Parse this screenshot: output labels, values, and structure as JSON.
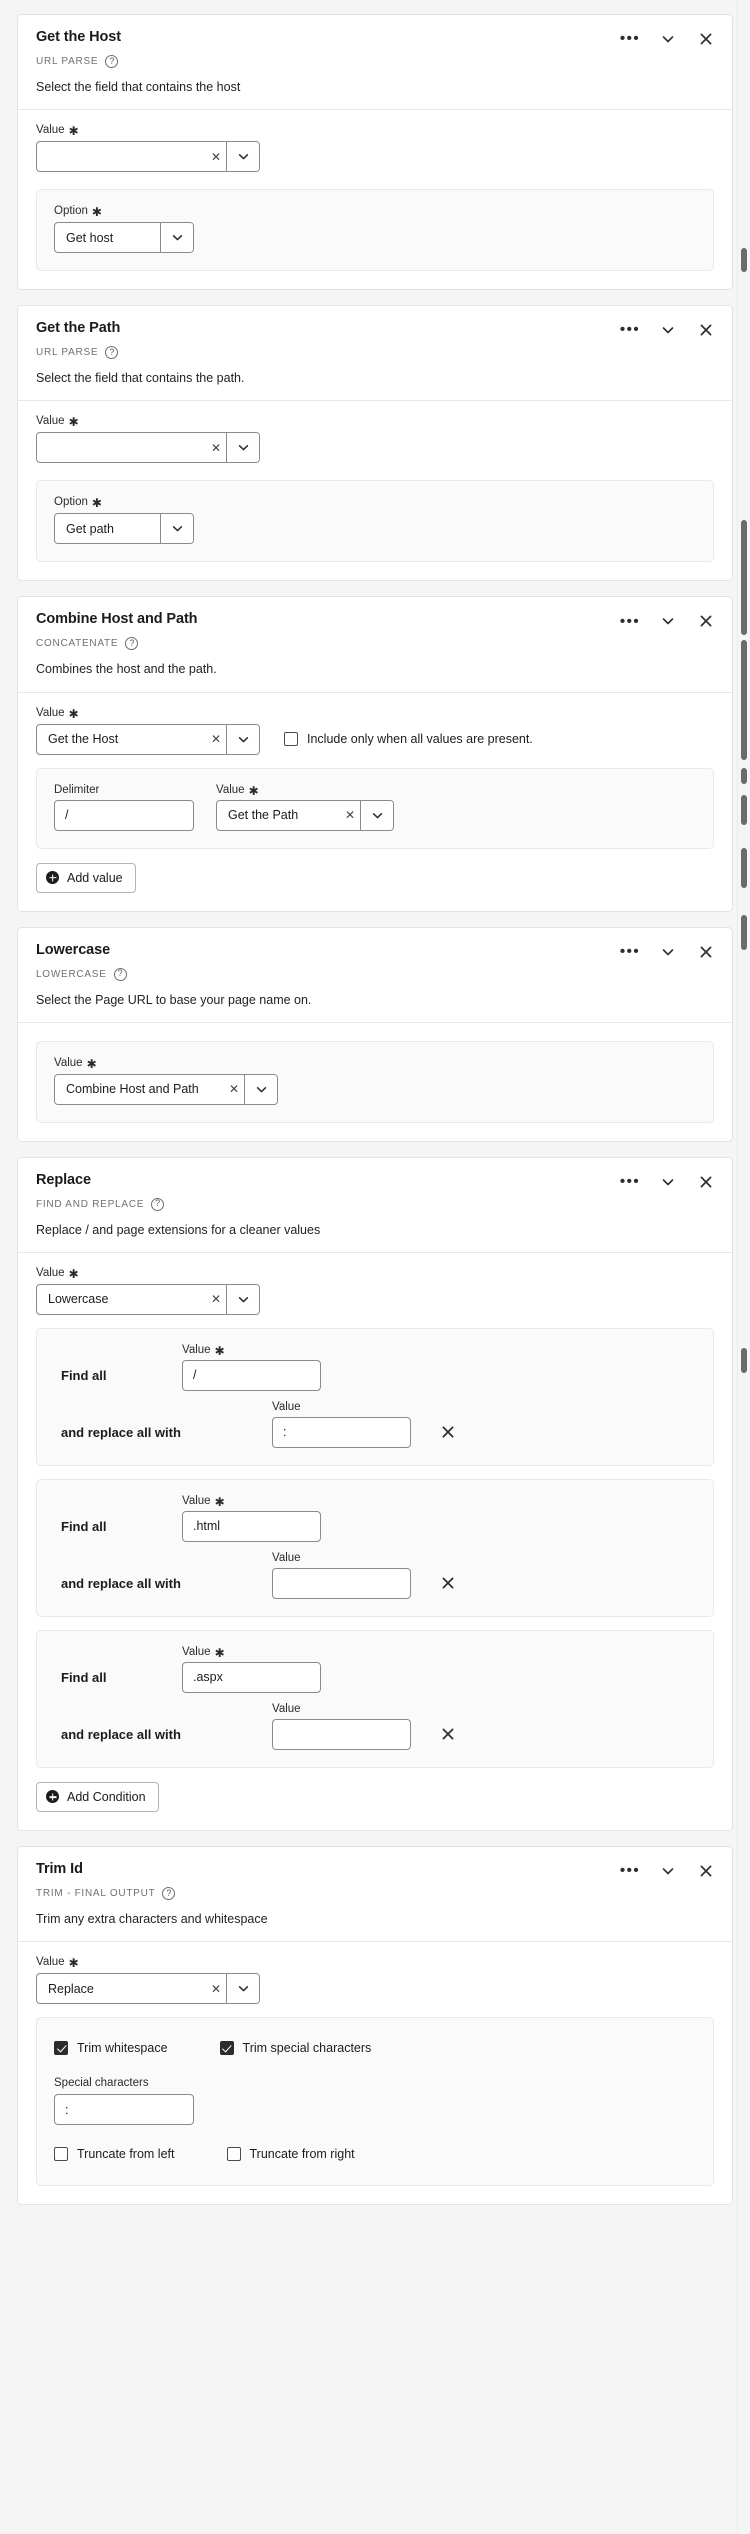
{
  "icons": {
    "more": "…",
    "collapse": "chevron-down",
    "close": "×",
    "help": "?",
    "clear": "×",
    "dropdown": "chevron-down"
  },
  "cards": [
    {
      "title": "Get the Host",
      "type_label": "URL PARSE",
      "description": "Select the field that contains the host",
      "value_label": "Value",
      "value": "",
      "option_label": "Option",
      "option_value": "Get host"
    },
    {
      "title": "Get the Path",
      "type_label": "URL PARSE",
      "description": "Select the field that contains the path.",
      "value_label": "Value",
      "value": "",
      "option_label": "Option",
      "option_value": "Get path"
    },
    {
      "title": "Combine Host and Path",
      "type_label": "CONCATENATE",
      "description": "Combines the host and the path.",
      "value_label": "Value",
      "value": "Get the Host",
      "include_checkbox_label": "Include only when all values are present.",
      "include_checked": false,
      "delimiter_label": "Delimiter",
      "delimiter_value": "/",
      "second_value_label": "Value",
      "second_value": "Get the Path",
      "add_value_label": "Add value"
    },
    {
      "title": "Lowercase",
      "type_label": "LOWERCASE",
      "description": "Select the Page URL to base your page name on.",
      "value_label": "Value",
      "value": "Combine Host and Path"
    },
    {
      "title": "Replace",
      "type_label": "FIND AND REPLACE",
      "description": "Replace / and page extensions for a cleaner values",
      "value_label": "Value",
      "value": "Lowercase",
      "find_label": "Find all",
      "replace_label": "and replace all with",
      "find_value_label": "Value",
      "replace_value_label": "Value",
      "conditions": [
        {
          "find": "/",
          "replace": ":"
        },
        {
          "find": ".html",
          "replace": ""
        },
        {
          "find": ".aspx",
          "replace": ""
        }
      ],
      "add_condition_label": "Add Condition"
    },
    {
      "title": "Trim Id",
      "type_label": "TRIM - FINAL OUTPUT",
      "description": "Trim any extra characters and whitespace",
      "value_label": "Value",
      "value": "Replace",
      "trim_whitespace_label": "Trim whitespace",
      "trim_whitespace_checked": true,
      "trim_special_label": "Trim special characters",
      "trim_special_checked": true,
      "special_chars_label": "Special characters",
      "special_chars_value": ":",
      "truncate_left_label": "Truncate from left",
      "truncate_left_checked": false,
      "truncate_right_label": "Truncate from right",
      "truncate_right_checked": false
    }
  ],
  "colors": {
    "page_bg": "#f5f5f5",
    "card_bg": "#ffffff",
    "panel_bg": "#fafafa",
    "border": "#e3e3e3",
    "text": "#1b1b1b",
    "muted": "#707070"
  }
}
